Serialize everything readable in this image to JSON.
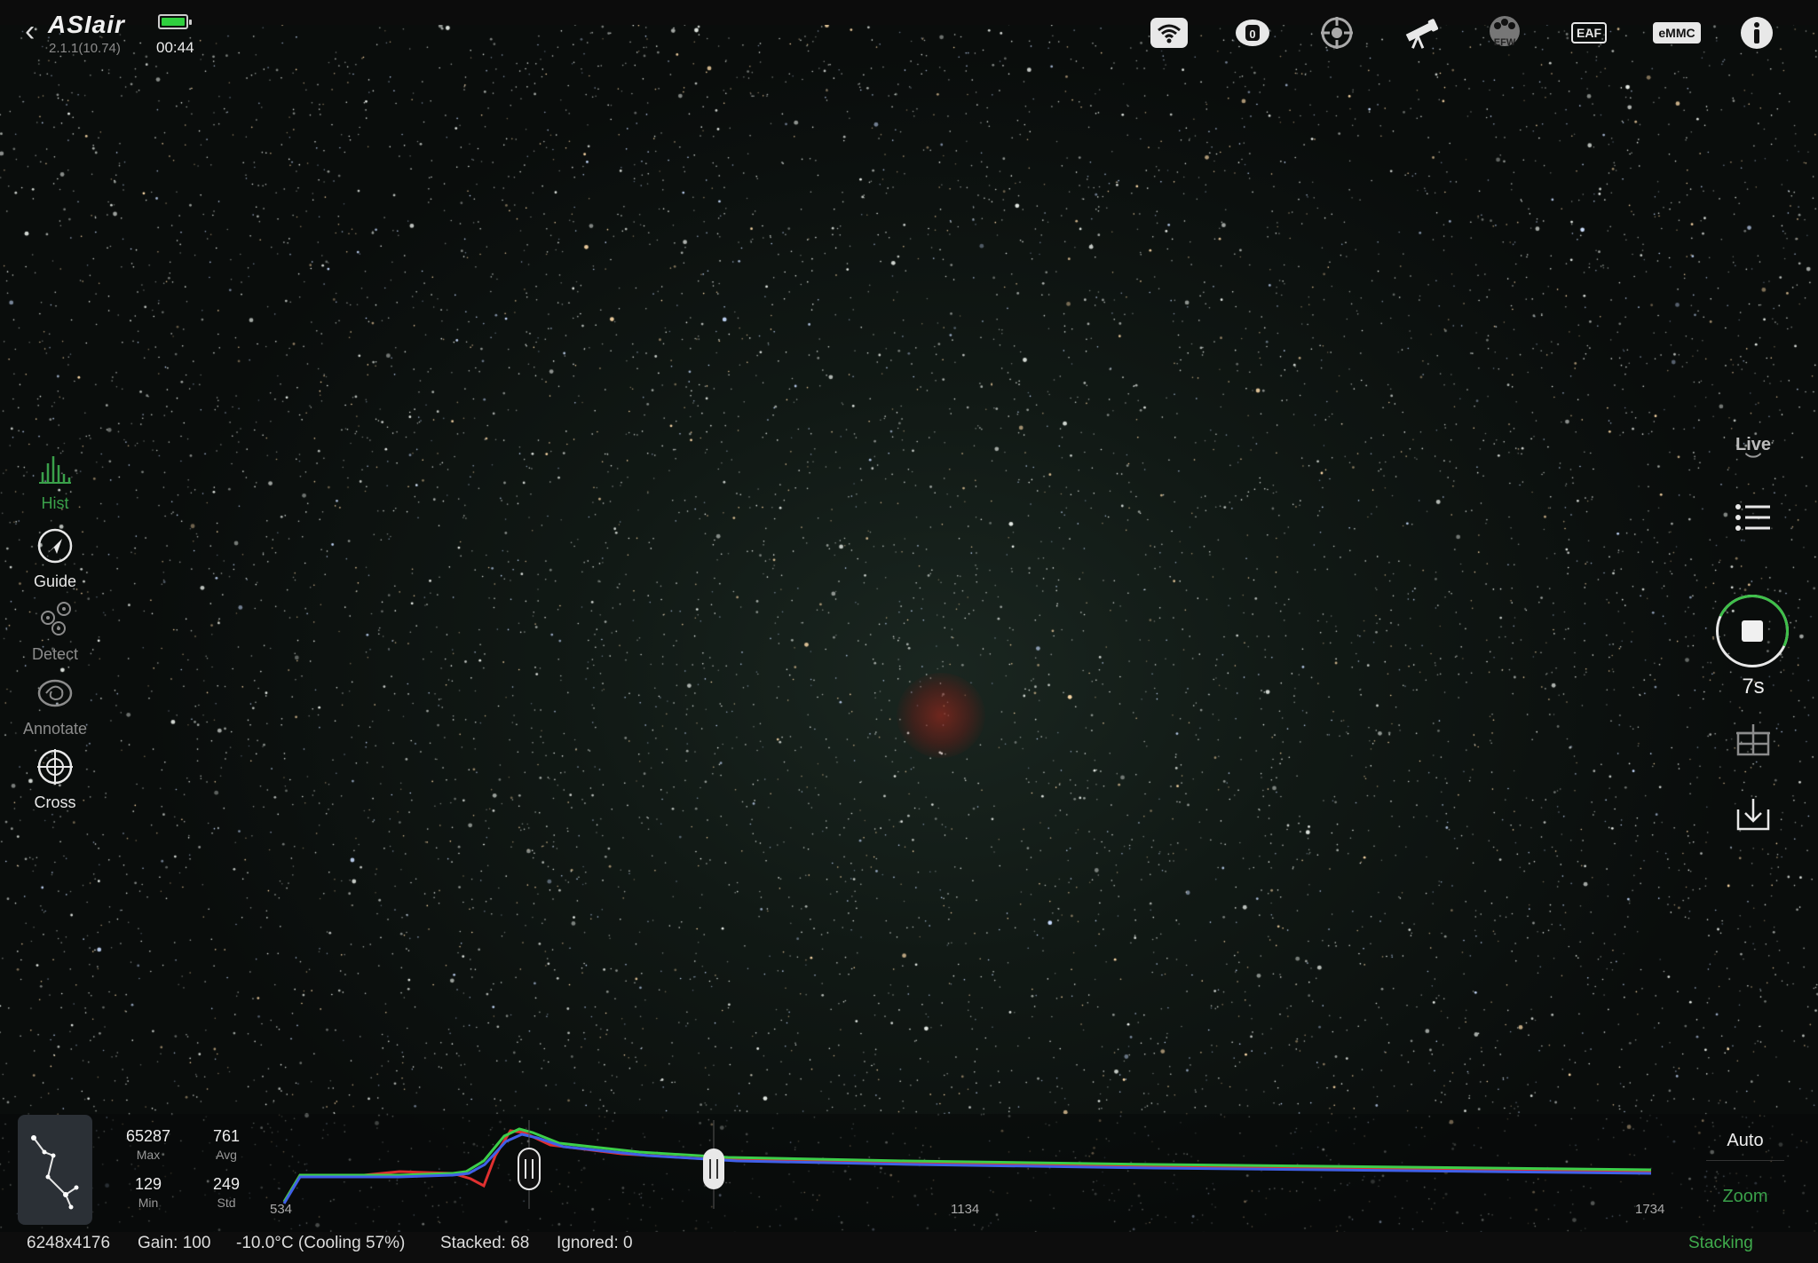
{
  "app": {
    "logo": "ASIair",
    "version": "2.1.1(10.74)",
    "clock": "00:44"
  },
  "topbar_icons": [
    {
      "name": "wifi-icon"
    },
    {
      "name": "camera-icon"
    },
    {
      "name": "guide-scope-icon"
    },
    {
      "name": "telescope-icon"
    },
    {
      "name": "filter-wheel-icon",
      "label": "EFW"
    },
    {
      "name": "focuser-icon",
      "label": "EAF"
    },
    {
      "name": "storage-icon",
      "label": "eMMC"
    },
    {
      "name": "info-icon"
    }
  ],
  "tools": [
    {
      "id": "hist",
      "label": "Hist",
      "icon": "histogram-icon",
      "color": "#3aa04a"
    },
    {
      "id": "guide",
      "label": "Guide",
      "icon": "compass-icon",
      "color": "#e8e8e8"
    },
    {
      "id": "detect",
      "label": "Detect",
      "icon": "detect-icon",
      "color": "#8c8c8c"
    },
    {
      "id": "annotate",
      "label": "Annotate",
      "icon": "galaxy-icon",
      "color": "#8c8c8c"
    },
    {
      "id": "cross",
      "label": "Cross",
      "icon": "crosshair-icon",
      "color": "#e8e8e8"
    }
  ],
  "right": {
    "mode": "Live",
    "exposure": "7s"
  },
  "histogram": {
    "stats": {
      "max": "65287",
      "max_label": "Max",
      "avg": "761",
      "avg_label": "Avg",
      "min": "129",
      "min_label": "Min",
      "std": "249",
      "std_label": "Std"
    },
    "axis": {
      "left": "534",
      "mid": "1134",
      "right": "1734"
    },
    "auto_label": "Auto",
    "zoom_label": "Zoom"
  },
  "status": {
    "resolution": "6248x4176",
    "gain": "Gain: 100",
    "temp": "-10.0°C (Cooling 57%)",
    "stacked": "Stacked: 68",
    "ignored": "Ignored: 0",
    "state": "Stacking"
  },
  "colors": {
    "accent": "#3aa04a",
    "hist_red": "#e03030",
    "hist_green": "#3ccf4a",
    "hist_blue": "#4060e8"
  }
}
